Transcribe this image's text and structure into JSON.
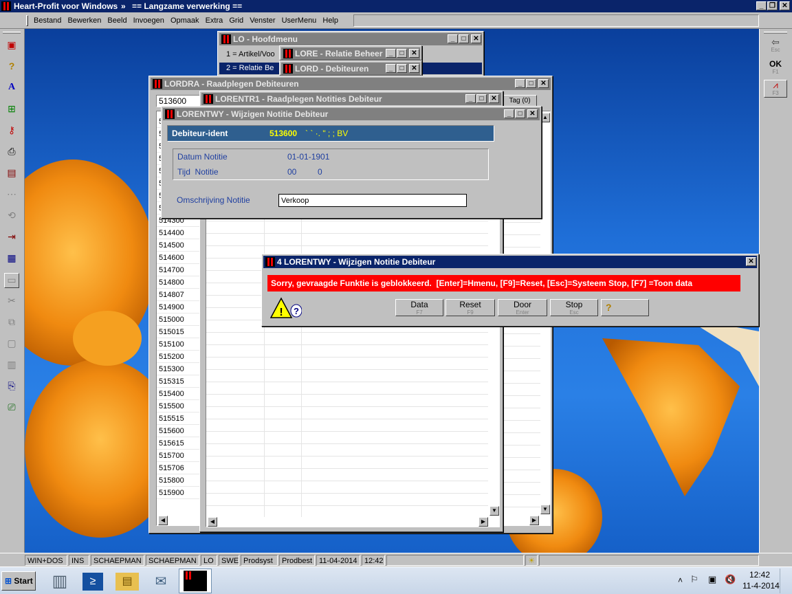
{
  "app": {
    "title": "Heart-Profit voor Windows",
    "subtitle_arrow": "»",
    "subtitle": "== Langzame verwerking =="
  },
  "menu": {
    "items": [
      "Bestand",
      "Bewerken",
      "Beeld",
      "Invoegen",
      "Opmaak",
      "Extra",
      "Grid",
      "Venster",
      "UserMenu",
      "Help"
    ]
  },
  "right_toolbar": {
    "esc_label": "Esc",
    "ok_label": "OK",
    "f1_label": "F1",
    "f3_label": "F3"
  },
  "windows": {
    "hoofdmenu": {
      "title": "LO - Hoofdmenu",
      "item1": "1 = Artikel/Voo",
      "item2": "2 = Relatie Be"
    },
    "lore": {
      "title": "LORE - Relatie Beheer"
    },
    "lord": {
      "title": "LORD - Debiteuren"
    },
    "lordra": {
      "title": "LORDRA - Raadplegen Debiteuren",
      "search_value": "513600",
      "tab_label": "Tag (0)",
      "rows": [
        "5",
        "5",
        "5",
        "5",
        "5",
        "5",
        "5",
        "5",
        "514300",
        "514400",
        "514500",
        "514600",
        "514700",
        "514800",
        "514807",
        "514900",
        "515000",
        "515015",
        "515100",
        "515200",
        "515300",
        "515315",
        "515400",
        "515500",
        "515515",
        "515600",
        "515615",
        "515700",
        "515706",
        "515800",
        "515900"
      ]
    },
    "lorentr1": {
      "title": "LORENTR1 - Raadplegen Notities Debiteur"
    },
    "lorentwy": {
      "title": "LORENTWY - Wijzigen Notitie Debiteur",
      "header_label": "Debiteur-ident",
      "header_value": "513600",
      "header_name": "` ` ·. \" ; ; BV",
      "datum_label": "Datum Notitie",
      "datum_value": "01-01-1901",
      "tijd_label": "Tijd  Notitie",
      "tijd_h": "00",
      "tijd_m": "0",
      "omschrijving_label": "Omschrijving Notitie",
      "omschrijving_value": "Verkoop"
    },
    "dialog": {
      "title": "4 LORENTWY - Wijzigen Notitie Debiteur",
      "message": "Sorry, gevraagde Funktie is geblokkeerd.  [Enter]=Hmenu, [F9]=Reset, [Esc]=Systeem Stop, [F7] =Toon data",
      "buttons": [
        {
          "label": "Data",
          "key": "F7"
        },
        {
          "label": "Reset",
          "key": "F9"
        },
        {
          "label": "Door",
          "key": "Enter"
        },
        {
          "label": "Stop",
          "key": "Esc"
        }
      ]
    }
  },
  "statusbar": {
    "cells": [
      "WIN+DOS",
      "INS",
      "SCHAEPMAN",
      "SCHAEPMAN",
      "LO",
      "SWE",
      "Prodsyst",
      "Prodbest",
      "11-04-2014",
      "12:42"
    ]
  },
  "taskbar": {
    "start_label": "Start",
    "time": "12:42",
    "date": "11-4-2014",
    "show_hidden": "˄"
  },
  "colors": {
    "desktop": "#1a5fc4",
    "titlebar_active": "#0a246a",
    "titlebar_inactive": "#808080",
    "error_bar": "#ff0000",
    "header_bar": "#2f5f8f",
    "label_blue": "#1f3fa0",
    "header_value_yellow": "#ffff00"
  }
}
